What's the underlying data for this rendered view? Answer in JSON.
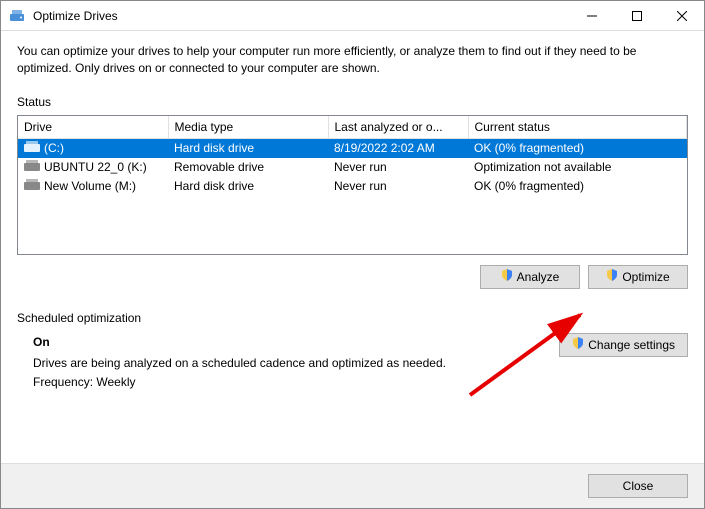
{
  "window": {
    "title": "Optimize Drives"
  },
  "intro": "You can optimize your drives to help your computer run more efficiently, or analyze them to find out if they need to be optimized. Only drives on or connected to your computer are shown.",
  "statusLabel": "Status",
  "table": {
    "headers": {
      "drive": "Drive",
      "media": "Media type",
      "last": "Last analyzed or o...",
      "status": "Current status"
    },
    "rows": [
      {
        "name": "(C:)",
        "media": "Hard disk drive",
        "last": "8/19/2022 2:02 AM",
        "status": "OK (0% fragmented)",
        "selected": true,
        "iconColor": "#3b82f6"
      },
      {
        "name": "UBUNTU 22_0 (K:)",
        "media": "Removable drive",
        "last": "Never run",
        "status": "Optimization not available",
        "selected": false,
        "iconColor": "#888"
      },
      {
        "name": "New Volume (M:)",
        "media": "Hard disk drive",
        "last": "Never run",
        "status": "OK (0% fragmented)",
        "selected": false,
        "iconColor": "#888"
      }
    ]
  },
  "buttons": {
    "analyze": "Analyze",
    "optimize": "Optimize",
    "change": "Change settings",
    "close": "Close"
  },
  "sched": {
    "label": "Scheduled optimization",
    "on": "On",
    "desc": "Drives are being analyzed on a scheduled cadence and optimized as needed.",
    "freq": "Frequency: Weekly"
  }
}
